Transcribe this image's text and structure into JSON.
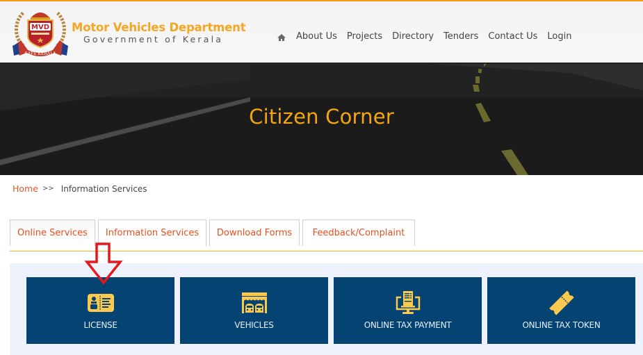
{
  "header": {
    "logo": {
      "badge_text": "MVD",
      "ribbon_text": "SAFE KERALA"
    },
    "brand_title": "Motor Vehicles Department",
    "brand_subtitle": "Government of Kerala",
    "accent_color": "#f39c12"
  },
  "nav": {
    "home_icon": "home-icon",
    "items": [
      {
        "label": "About Us"
      },
      {
        "label": "Projects"
      },
      {
        "label": "Directory"
      },
      {
        "label": "Tenders"
      },
      {
        "label": "Contact Us"
      },
      {
        "label": "Login"
      }
    ]
  },
  "banner": {
    "title": "Citizen Corner",
    "title_color": "#f5a50f"
  },
  "breadcrumb": {
    "home": "Home",
    "separator": ">>",
    "current": "Information Services"
  },
  "tabs": [
    {
      "label": "Online Services",
      "active": true
    },
    {
      "label": "Information Services",
      "active": false
    },
    {
      "label": "Download Forms",
      "active": false
    },
    {
      "label": "Feedback/Complaint",
      "active": false
    }
  ],
  "services": [
    {
      "label": "LICENSE",
      "icon": "license-card-icon"
    },
    {
      "label": "VEHICLES",
      "icon": "garage-cars-icon"
    },
    {
      "label": "ONLINE TAX PAYMENT",
      "icon": "computer-receipt-icon"
    },
    {
      "label": "ONLINE TAX TOKEN",
      "icon": "ticket-icon"
    }
  ],
  "annotation": {
    "icon": "red-down-arrow-icon",
    "color": "#e8171d"
  },
  "colors": {
    "card_bg": "#054472",
    "icon_color": "#fcc94f",
    "tab_text": "#e8501e",
    "panel_bg": "#eef2fd"
  }
}
